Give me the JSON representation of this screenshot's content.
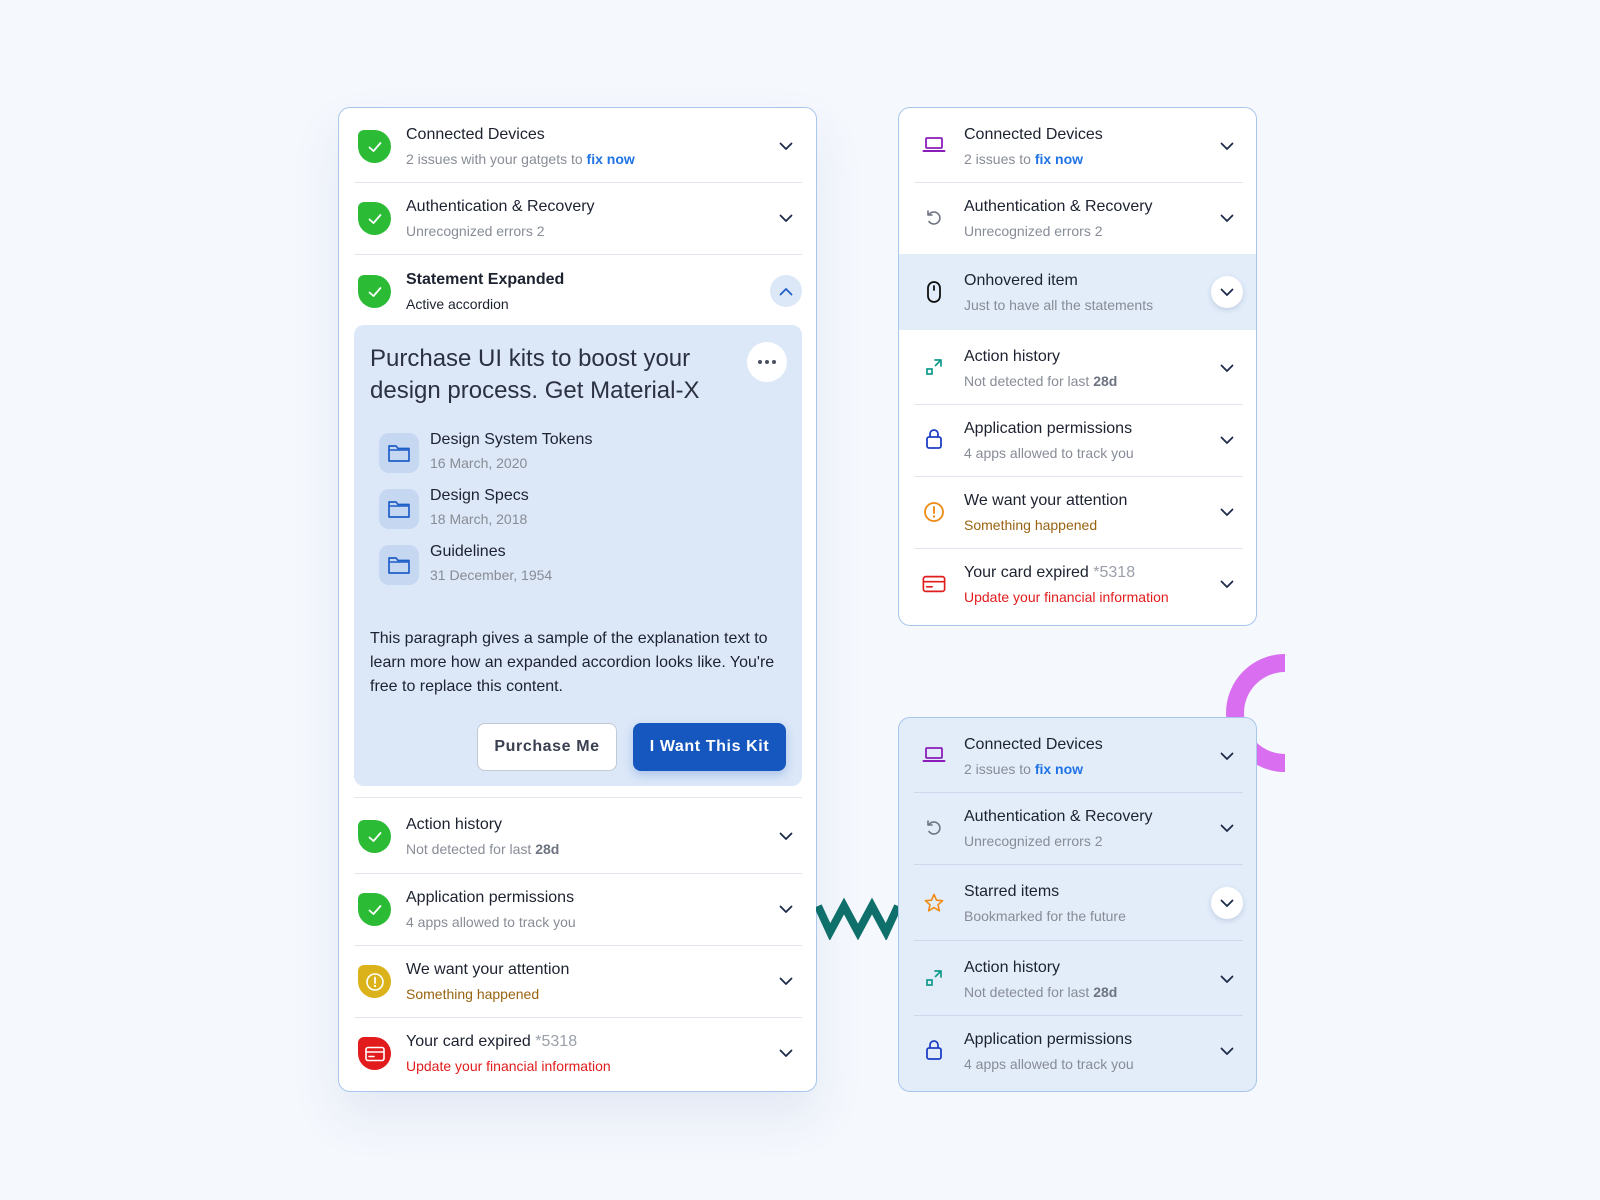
{
  "left_panel": {
    "rows": [
      {
        "title": "Connected Devices",
        "sub_prefix": "2 issues with your gatgets to ",
        "sub_link": "fix now"
      },
      {
        "title": "Authentication & Recovery",
        "sub": "Unrecognized errors 2"
      },
      {
        "title": "Statement Expanded",
        "sub": "Active accordion"
      }
    ],
    "expanded": {
      "headline": "Purchase UI kits to boost your design process. Get Material-X",
      "files": [
        {
          "name": "Design System Tokens",
          "date": "16 March, 2020"
        },
        {
          "name": "Design Specs",
          "date": "18 March, 2018"
        },
        {
          "name": "Guidelines",
          "date": "31 December, 1954"
        }
      ],
      "paragraph": "This paragraph gives a sample of the explanation text to learn more how an expanded accordion looks like. You're free to replace this content.",
      "secondary_button": "Purchase Me",
      "primary_button": "I Want This Kit"
    },
    "rows_after": [
      {
        "title": "Action history",
        "sub_prefix": "Not detected for last ",
        "sub_bold": "28d"
      },
      {
        "title": "Application permissions",
        "sub": "4 apps allowed to track you"
      },
      {
        "title": "We want your attention",
        "sub": "Something happened"
      },
      {
        "title_prefix": "Your card expired ",
        "title_muted": "*5318",
        "sub": "Update your financial information"
      }
    ]
  },
  "right_top_panel": {
    "rows": [
      {
        "title": "Connected Devices",
        "sub_prefix": "2 issues to ",
        "sub_link": "fix now",
        "icon": "laptop-icon"
      },
      {
        "title": "Authentication & Recovery",
        "sub": "Unrecognized errors 2",
        "icon": "history-icon"
      },
      {
        "title": "Onhovered item",
        "sub": "Just to have all the statements",
        "icon": "mouse-icon"
      },
      {
        "title": "Action history",
        "sub_prefix": "Not detected for last ",
        "sub_bold": "28d",
        "icon": "expand-arrows-icon"
      },
      {
        "title": "Application permissions",
        "sub": "4 apps allowed to track you",
        "icon": "lock-icon"
      },
      {
        "title": "We want your attention",
        "sub": "Something happened",
        "icon": "alert-icon"
      },
      {
        "title_prefix": "Your card expired ",
        "title_muted": "*5318",
        "sub": "Update your financial information",
        "icon": "credit-card-icon"
      }
    ]
  },
  "right_bottom_panel": {
    "rows": [
      {
        "title": "Connected Devices",
        "sub_prefix": "2 issues to ",
        "sub_link": "fix now",
        "icon": "laptop-icon"
      },
      {
        "title": "Authentication & Recovery",
        "sub": "Unrecognized errors 2",
        "icon": "history-icon"
      },
      {
        "title": "Starred items",
        "sub": "Bookmarked for the future",
        "icon": "star-icon"
      },
      {
        "title": "Action history",
        "sub_prefix": "Not detected for last ",
        "sub_bold": "28d",
        "icon": "expand-arrows-icon"
      },
      {
        "title": "Application permissions",
        "sub": "4 apps allowed to track you",
        "icon": "lock-icon"
      }
    ]
  },
  "colors": {
    "success": "#2cbb35",
    "warning": "#dbb21a",
    "error": "#e21c1c",
    "primary": "#1557be",
    "link": "#1f73e6",
    "accent_purple": "#d96ff0",
    "accent_teal": "#0f6f6b"
  }
}
